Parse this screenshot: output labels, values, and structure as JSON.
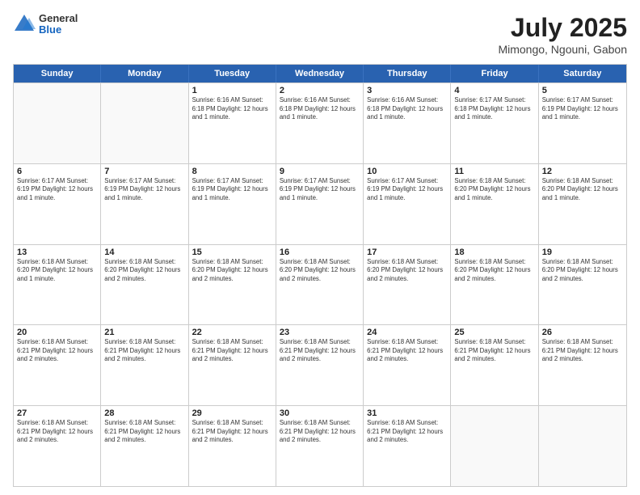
{
  "header": {
    "logo": {
      "general": "General",
      "blue": "Blue"
    },
    "title": "July 2025",
    "subtitle": "Mimongo, Ngouni, Gabon"
  },
  "calendar": {
    "days_of_week": [
      "Sunday",
      "Monday",
      "Tuesday",
      "Wednesday",
      "Thursday",
      "Friday",
      "Saturday"
    ],
    "weeks": [
      [
        {
          "day": "",
          "empty": true
        },
        {
          "day": "",
          "empty": true
        },
        {
          "day": "1",
          "info": "Sunrise: 6:16 AM\nSunset: 6:18 PM\nDaylight: 12 hours\nand 1 minute."
        },
        {
          "day": "2",
          "info": "Sunrise: 6:16 AM\nSunset: 6:18 PM\nDaylight: 12 hours\nand 1 minute."
        },
        {
          "day": "3",
          "info": "Sunrise: 6:16 AM\nSunset: 6:18 PM\nDaylight: 12 hours\nand 1 minute."
        },
        {
          "day": "4",
          "info": "Sunrise: 6:17 AM\nSunset: 6:18 PM\nDaylight: 12 hours\nand 1 minute."
        },
        {
          "day": "5",
          "info": "Sunrise: 6:17 AM\nSunset: 6:19 PM\nDaylight: 12 hours\nand 1 minute."
        }
      ],
      [
        {
          "day": "6",
          "info": "Sunrise: 6:17 AM\nSunset: 6:19 PM\nDaylight: 12 hours\nand 1 minute."
        },
        {
          "day": "7",
          "info": "Sunrise: 6:17 AM\nSunset: 6:19 PM\nDaylight: 12 hours\nand 1 minute."
        },
        {
          "day": "8",
          "info": "Sunrise: 6:17 AM\nSunset: 6:19 PM\nDaylight: 12 hours\nand 1 minute."
        },
        {
          "day": "9",
          "info": "Sunrise: 6:17 AM\nSunset: 6:19 PM\nDaylight: 12 hours\nand 1 minute."
        },
        {
          "day": "10",
          "info": "Sunrise: 6:17 AM\nSunset: 6:19 PM\nDaylight: 12 hours\nand 1 minute."
        },
        {
          "day": "11",
          "info": "Sunrise: 6:18 AM\nSunset: 6:20 PM\nDaylight: 12 hours\nand 1 minute."
        },
        {
          "day": "12",
          "info": "Sunrise: 6:18 AM\nSunset: 6:20 PM\nDaylight: 12 hours\nand 1 minute."
        }
      ],
      [
        {
          "day": "13",
          "info": "Sunrise: 6:18 AM\nSunset: 6:20 PM\nDaylight: 12 hours\nand 1 minute."
        },
        {
          "day": "14",
          "info": "Sunrise: 6:18 AM\nSunset: 6:20 PM\nDaylight: 12 hours\nand 2 minutes."
        },
        {
          "day": "15",
          "info": "Sunrise: 6:18 AM\nSunset: 6:20 PM\nDaylight: 12 hours\nand 2 minutes."
        },
        {
          "day": "16",
          "info": "Sunrise: 6:18 AM\nSunset: 6:20 PM\nDaylight: 12 hours\nand 2 minutes."
        },
        {
          "day": "17",
          "info": "Sunrise: 6:18 AM\nSunset: 6:20 PM\nDaylight: 12 hours\nand 2 minutes."
        },
        {
          "day": "18",
          "info": "Sunrise: 6:18 AM\nSunset: 6:20 PM\nDaylight: 12 hours\nand 2 minutes."
        },
        {
          "day": "19",
          "info": "Sunrise: 6:18 AM\nSunset: 6:20 PM\nDaylight: 12 hours\nand 2 minutes."
        }
      ],
      [
        {
          "day": "20",
          "info": "Sunrise: 6:18 AM\nSunset: 6:21 PM\nDaylight: 12 hours\nand 2 minutes."
        },
        {
          "day": "21",
          "info": "Sunrise: 6:18 AM\nSunset: 6:21 PM\nDaylight: 12 hours\nand 2 minutes."
        },
        {
          "day": "22",
          "info": "Sunrise: 6:18 AM\nSunset: 6:21 PM\nDaylight: 12 hours\nand 2 minutes."
        },
        {
          "day": "23",
          "info": "Sunrise: 6:18 AM\nSunset: 6:21 PM\nDaylight: 12 hours\nand 2 minutes."
        },
        {
          "day": "24",
          "info": "Sunrise: 6:18 AM\nSunset: 6:21 PM\nDaylight: 12 hours\nand 2 minutes."
        },
        {
          "day": "25",
          "info": "Sunrise: 6:18 AM\nSunset: 6:21 PM\nDaylight: 12 hours\nand 2 minutes."
        },
        {
          "day": "26",
          "info": "Sunrise: 6:18 AM\nSunset: 6:21 PM\nDaylight: 12 hours\nand 2 minutes."
        }
      ],
      [
        {
          "day": "27",
          "info": "Sunrise: 6:18 AM\nSunset: 6:21 PM\nDaylight: 12 hours\nand 2 minutes."
        },
        {
          "day": "28",
          "info": "Sunrise: 6:18 AM\nSunset: 6:21 PM\nDaylight: 12 hours\nand 2 minutes."
        },
        {
          "day": "29",
          "info": "Sunrise: 6:18 AM\nSunset: 6:21 PM\nDaylight: 12 hours\nand 2 minutes."
        },
        {
          "day": "30",
          "info": "Sunrise: 6:18 AM\nSunset: 6:21 PM\nDaylight: 12 hours\nand 2 minutes."
        },
        {
          "day": "31",
          "info": "Sunrise: 6:18 AM\nSunset: 6:21 PM\nDaylight: 12 hours\nand 2 minutes."
        },
        {
          "day": "",
          "empty": true
        },
        {
          "day": "",
          "empty": true
        }
      ]
    ]
  }
}
